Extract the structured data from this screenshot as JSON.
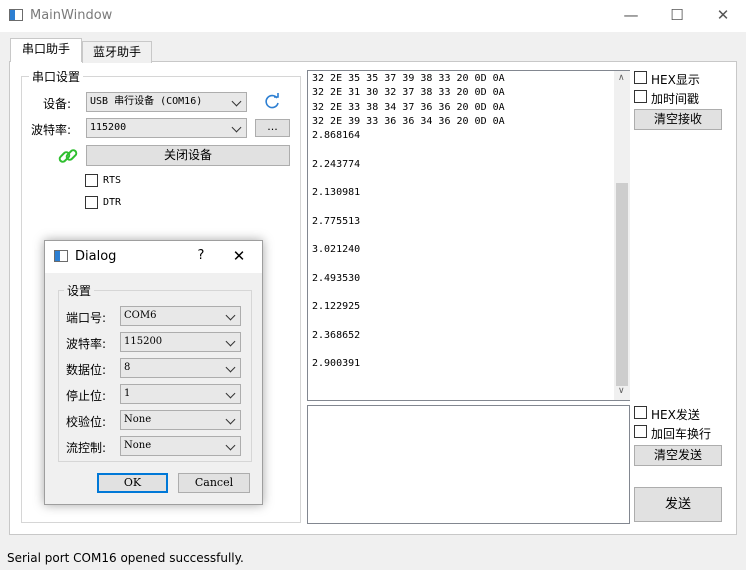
{
  "window": {
    "title": "MainWindow"
  },
  "tabs": [
    {
      "label": "串口助手"
    },
    {
      "label": "蓝牙助手"
    }
  ],
  "serial_group": {
    "title": "串口设置",
    "device_label": "设备:",
    "device_value": "USB 串行设备 (COM16)",
    "baud_label": "波特率:",
    "baud_value": "115200",
    "more_label": "...",
    "close_button": "关闭设备",
    "rts_label": "RTS",
    "dtr_label": "DTR"
  },
  "receive": {
    "lines": [
      "32 2E 35 35 37 39 38 33 20 0D 0A",
      "32 2E 31 30 32 37 38 33 20 0D 0A",
      "32 2E 33 38 34 37 36 36 20 0D 0A",
      "32 2E 39 33 36 36 34 36 20 0D 0A",
      "2.868164",
      "",
      "2.243774",
      "",
      "2.130981",
      "",
      "2.775513",
      "",
      "3.021240",
      "",
      "2.493530",
      "",
      "2.122925",
      "",
      "2.368652",
      "",
      "2.900391"
    ],
    "hex_display_label": "HEX显示",
    "timestamp_label": "加时间戳",
    "clear_button": "清空接收"
  },
  "send": {
    "hex_send_label": "HEX发送",
    "newline_label": "加回车换行",
    "clear_button": "清空发送",
    "send_button": "发送"
  },
  "dialog": {
    "title": "Dialog",
    "help_label": "?",
    "group_title": "设置",
    "fields": [
      {
        "label": "端口号:",
        "value": "COM6"
      },
      {
        "label": "波特率:",
        "value": "115200"
      },
      {
        "label": "数据位:",
        "value": "8"
      },
      {
        "label": "停止位:",
        "value": "1"
      },
      {
        "label": "校验位:",
        "value": "None"
      },
      {
        "label": "流控制:",
        "value": "None"
      }
    ],
    "ok_label": "OK",
    "cancel_label": "Cancel"
  },
  "status": {
    "message": "Serial port COM16 opened successfully."
  },
  "colors": {
    "accent": "#0078d7",
    "link_icon": "#2fbf2f",
    "refresh_icon": "#2d7fd2"
  }
}
